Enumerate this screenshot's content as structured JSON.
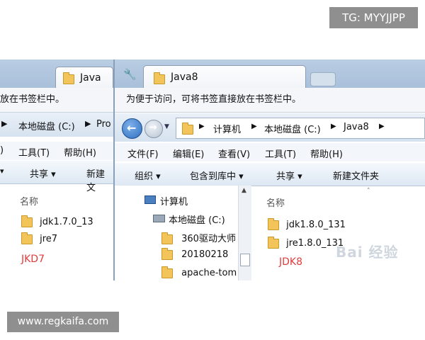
{
  "overlay": {
    "tg_label": "TG: MYYJJPP",
    "site_label": "www.regkaifa.com"
  },
  "left_window": {
    "tab_title": "Java",
    "favorites_hint": "放在书签栏中。",
    "address": {
      "drive": "本地磁盘 (C:)",
      "next": "Pro"
    },
    "menu": {
      "tools": "工具(T)",
      "help": "帮助(H)"
    },
    "commands": {
      "share": "共享 ▾",
      "new": "新建文"
    },
    "column_name": "名称",
    "files": [
      "jdk1.7.0_13",
      "jre7"
    ],
    "annotation": "JKD7"
  },
  "right_window": {
    "tab_title": "Java8",
    "favorites_hint": "为便于访问，可将书签直接放在书签栏中。",
    "address": {
      "computer": "计算机",
      "drive": "本地磁盘 (C:)",
      "folder": "Java8"
    },
    "menu": {
      "file": "文件(F)",
      "edit": "编辑(E)",
      "view": "查看(V)",
      "tools": "工具(T)",
      "help": "帮助(H)"
    },
    "commands": {
      "organize": "组织 ▾",
      "include": "包含到库中 ▾",
      "share": "共享 ▾",
      "new_folder": "新建文件夹"
    },
    "tree": [
      "计算机",
      "本地磁盘 (C:)",
      "360驱动大师",
      "20180218",
      "apache-tom"
    ],
    "column_name": "名称",
    "files": [
      "jdk1.8.0_131",
      "jre1.8.0_131"
    ],
    "annotation": "JDK8",
    "watermark": "Bai 经验"
  },
  "colors": {
    "annotation_red": "#e23b3b",
    "folder_yellow": "#f2c45a",
    "nav_blue": "#2f6fc0"
  },
  "icons": [
    "folder-icon",
    "computer-icon",
    "drive-icon",
    "back-arrow-icon",
    "forward-arrow-icon",
    "wrench-icon"
  ]
}
